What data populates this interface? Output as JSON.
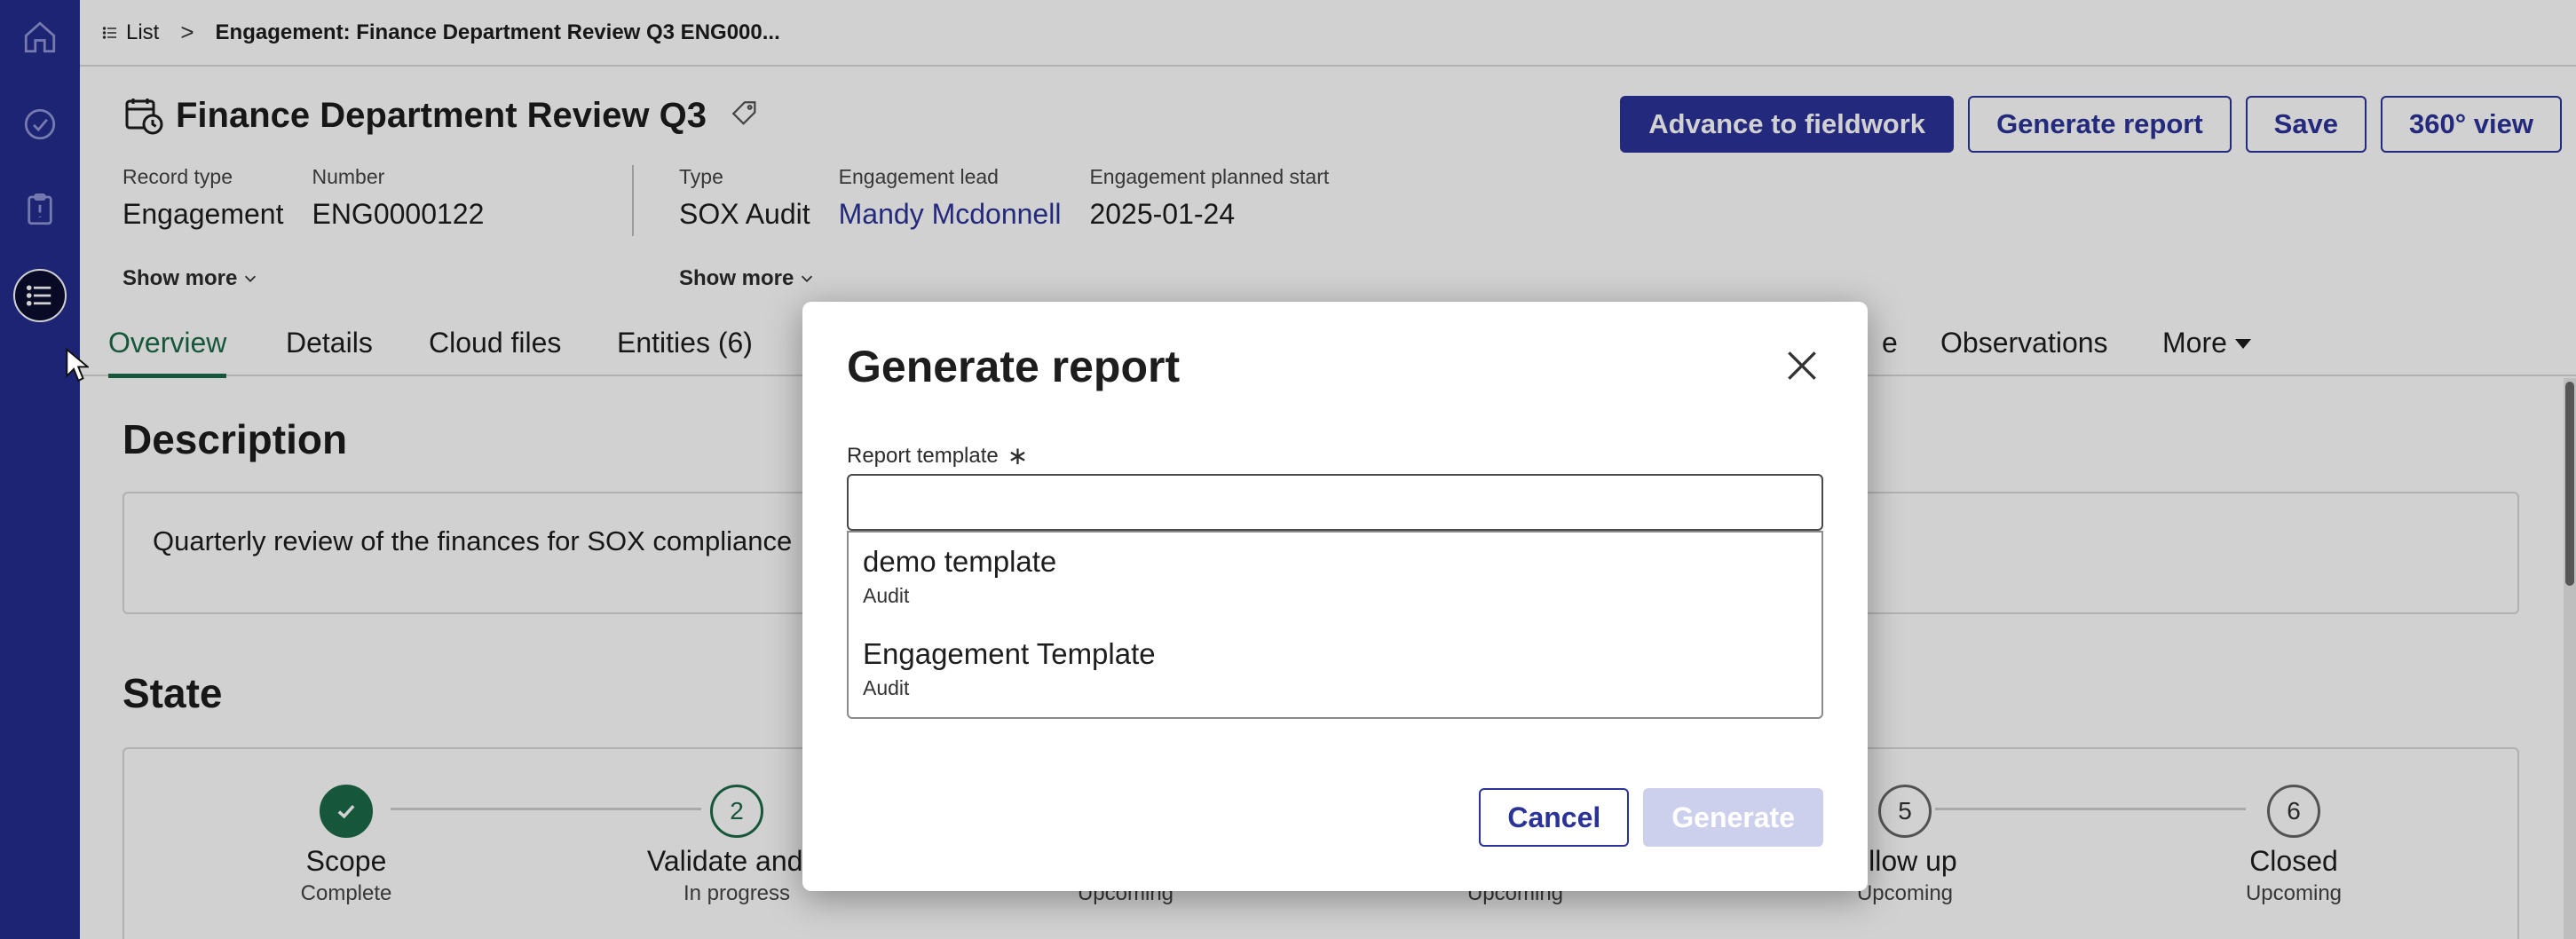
{
  "breadcrumb": {
    "list_label": "List",
    "separator": ">",
    "current": "Engagement: Finance Department Review Q3 ENG000..."
  },
  "record": {
    "title": "Finance Department Review Q3",
    "actions": {
      "advance": "Advance to fieldwork",
      "generate": "Generate report",
      "save": "Save",
      "view360": "360° view"
    },
    "fields_left": [
      {
        "label": "Record type",
        "value": "Engagement"
      },
      {
        "label": "Number",
        "value": "ENG0000122"
      }
    ],
    "fields_right": [
      {
        "label": "Type",
        "value": "SOX Audit"
      },
      {
        "label": "Engagement lead",
        "value": "Mandy Mcdonnell"
      },
      {
        "label": "Engagement planned start",
        "value": "2025-01-24"
      }
    ],
    "show_more": "Show more"
  },
  "tabs": [
    {
      "label": "Overview",
      "active": true
    },
    {
      "label": "Details"
    },
    {
      "label": "Cloud files"
    },
    {
      "label": "Entities (6)"
    },
    {
      "label": "e"
    },
    {
      "label": "Observations"
    },
    {
      "label": "More"
    }
  ],
  "description": {
    "heading": "Description",
    "text": "Quarterly review of the finances for SOX compliance"
  },
  "state": {
    "heading": "State",
    "steps": [
      {
        "number": "",
        "name": "Scope",
        "status": "Complete"
      },
      {
        "number": "2",
        "name": "Validate and p",
        "status": "In progress"
      },
      {
        "number": "",
        "name": "",
        "status": "Upcoming"
      },
      {
        "number": "",
        "name": "",
        "status": "Upcoming"
      },
      {
        "number": "5",
        "name": "ollow up",
        "status": "Upcoming"
      },
      {
        "number": "6",
        "name": "Closed",
        "status": "Upcoming"
      }
    ]
  },
  "modal": {
    "title": "Generate report",
    "field_label": "Report template",
    "required_mark": "∗",
    "input_value": "",
    "options": [
      {
        "title": "demo template",
        "subtitle": "Audit"
      },
      {
        "title": "Engagement Template",
        "subtitle": "Audit"
      }
    ],
    "cancel": "Cancel",
    "generate": "Generate"
  },
  "colors": {
    "rail": "#242c8e",
    "primary": "#2b3398",
    "accent_green": "#1b6b4a",
    "disabled": "#cdd0ec"
  },
  "icons": {
    "rail": [
      "home-icon",
      "check-circle-icon",
      "clipboard-icon",
      "list-icon"
    ],
    "title": "calendar-clock-icon",
    "tag": "tag-icon",
    "close": "close-icon"
  }
}
